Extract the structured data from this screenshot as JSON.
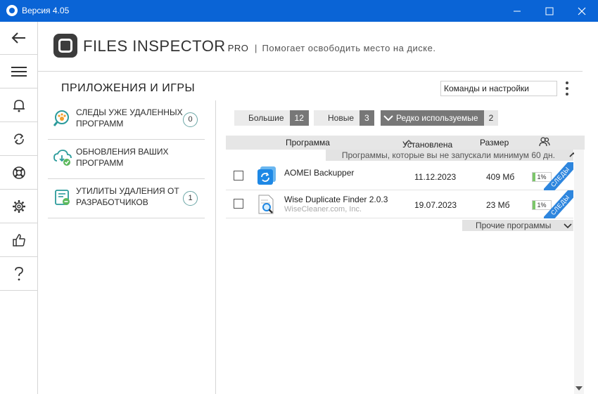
{
  "window": {
    "title": "Версия 4.05"
  },
  "header": {
    "brand": "FILES INSPECTOR",
    "pro": "PRO",
    "separator": "|",
    "tagline": "Помогает освободить место на диске."
  },
  "section": {
    "title": "ПРИЛОЖЕНИЯ И ИГРЫ"
  },
  "commands": {
    "label": "Команды и настройки"
  },
  "categories": [
    {
      "label": "Следы уже удаленных программ",
      "count": "0"
    },
    {
      "label": "Обновления ваших программ",
      "count": ""
    },
    {
      "label": "Утилиты удаления от разработчиков",
      "count": "1"
    }
  ],
  "filters": [
    {
      "label": "Большие",
      "count": "12"
    },
    {
      "label": "Новые",
      "count": "3"
    },
    {
      "label": "Редко используемые",
      "count": "2"
    }
  ],
  "table": {
    "columns": {
      "program": "Программа",
      "installed": "Установлена",
      "size": "Размер"
    },
    "group_rarely": "Программы, которые вы не запускали минимум 60 дн.",
    "group_other": "Прочие программы",
    "rows": [
      {
        "name": "AOMEI Backupper",
        "publisher": "",
        "date": "11.12.2023",
        "size": "409 Мб",
        "usage": "1%",
        "usage_fraction": 0.15,
        "ribbon": "СЛЕДЫ"
      },
      {
        "name": "Wise Duplicate Finder 2.0.3",
        "publisher": "WiseCleaner.com, Inc.",
        "date": "19.07.2023",
        "size": "23 Мб",
        "usage": "1%",
        "usage_fraction": 0.15,
        "ribbon": "СЛЕДЫ"
      }
    ]
  },
  "icons": {
    "rail": [
      "back-arrow-icon",
      "menu-icon",
      "bell-icon",
      "refresh-icon",
      "lifebuoy-icon",
      "gear-icon",
      "thumbs-up-icon",
      "help-icon"
    ]
  },
  "colors": {
    "titlebar": "#0a64d6",
    "ribbon": "#2e86de",
    "usage_fill": "#7cc66a",
    "teal_accent": "#2b9b9b"
  }
}
